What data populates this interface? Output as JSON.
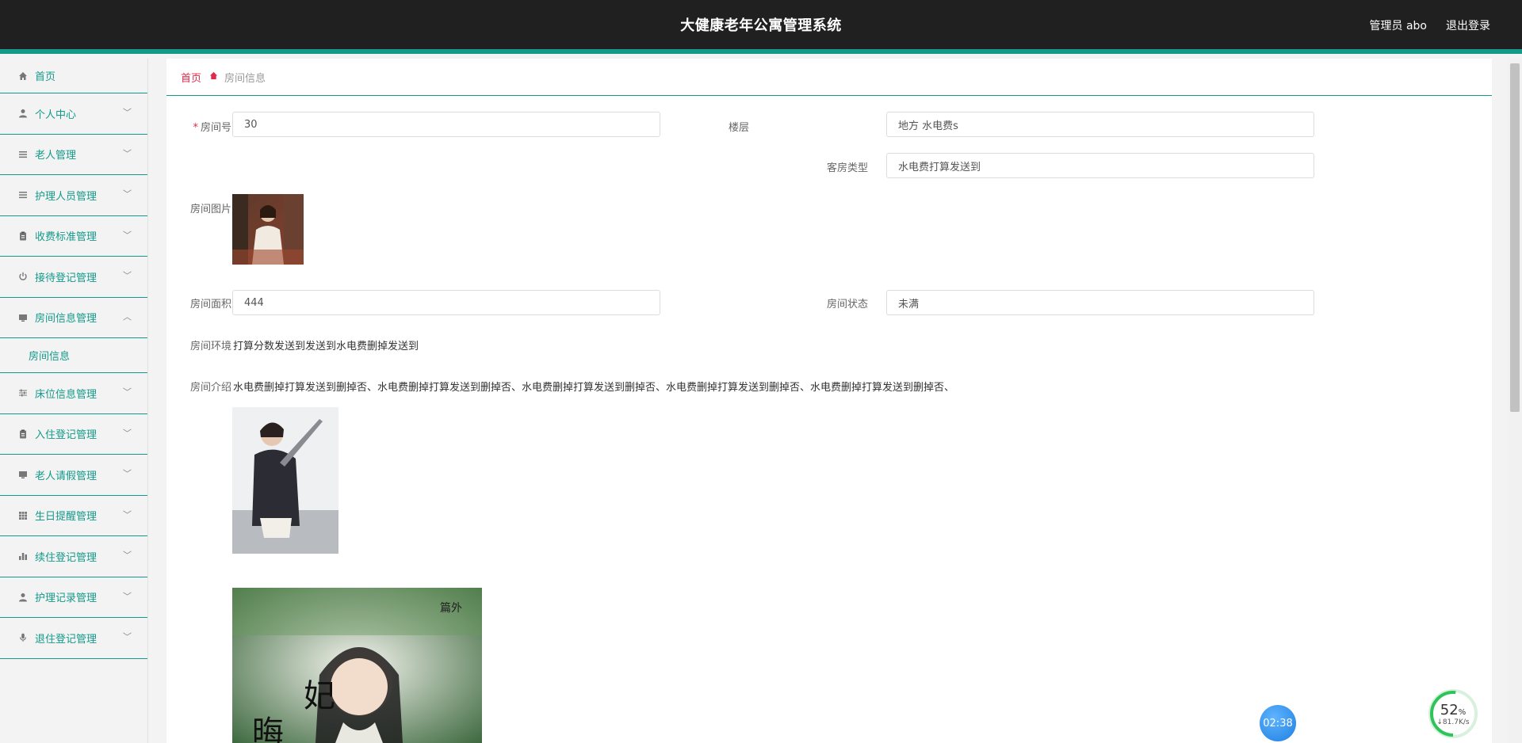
{
  "header": {
    "title": "大健康老年公寓管理系统",
    "user": "管理员 abo",
    "logout": "退出登录"
  },
  "sidebar": {
    "items": [
      {
        "label": "首页",
        "icon": "home-icon",
        "chevron": false
      },
      {
        "label": "个人中心",
        "icon": "user-icon",
        "chevron": true
      },
      {
        "label": "老人管理",
        "icon": "list-icon",
        "chevron": true
      },
      {
        "label": "护理人员管理",
        "icon": "list-icon",
        "chevron": true
      },
      {
        "label": "收费标准管理",
        "icon": "clipboard-icon",
        "chevron": true
      },
      {
        "label": "接待登记管理",
        "icon": "power-icon",
        "chevron": true
      },
      {
        "label": "房间信息管理",
        "icon": "monitor-icon",
        "chevron": true,
        "expanded": true,
        "sub": [
          "房间信息"
        ]
      },
      {
        "label": "床位信息管理",
        "icon": "sliders-icon",
        "chevron": true
      },
      {
        "label": "入住登记管理",
        "icon": "clipboard-icon",
        "chevron": true
      },
      {
        "label": "老人请假管理",
        "icon": "monitor-icon",
        "chevron": true
      },
      {
        "label": "生日提醒管理",
        "icon": "grid-icon",
        "chevron": true
      },
      {
        "label": "续住登记管理",
        "icon": "bar-chart-icon",
        "chevron": true
      },
      {
        "label": "护理记录管理",
        "icon": "user-icon",
        "chevron": true
      },
      {
        "label": "退住登记管理",
        "icon": "mic-icon",
        "chevron": true
      }
    ]
  },
  "breadcrumb": {
    "home": "首页",
    "current": "房间信息"
  },
  "form": {
    "room_no_label": "房间号",
    "room_no": "30",
    "floor_label": "楼层",
    "floor": "地方 水电费s",
    "room_type_label": "客房类型",
    "room_type": "水电费打算发送到",
    "room_image_label": "房间图片",
    "area_label": "房间面积",
    "area": "444",
    "status_label": "房间状态",
    "status": "未满",
    "env_label": "房间环境",
    "env": "打算分数发送到发送到水电费删掉发送到",
    "intro_label": "房间介绍",
    "intro": "水电费删掉打算发送到删掉否、水电费删掉打算发送到删掉否、水电费删掉打算发送到删掉否、水电费删掉打算发送到删掉否、水电费删掉打算发送到删掉否、"
  },
  "widgets": {
    "timer": "02:38",
    "net_percent": "52",
    "net_percent_unit": "%",
    "net_speed": "↓81.7K/s"
  },
  "colors": {
    "accent": "#139a8a",
    "danger": "#e0294a",
    "header_bg": "#202020"
  }
}
